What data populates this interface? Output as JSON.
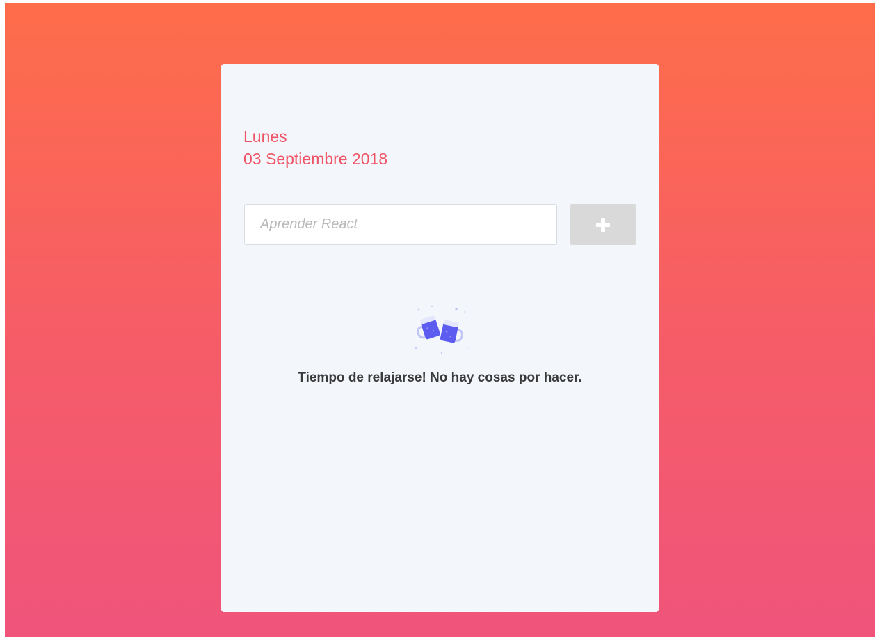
{
  "date": {
    "day": "Lunes",
    "full": "03 Septiembre 2018"
  },
  "task_input": {
    "value": "",
    "placeholder": "Aprender React"
  },
  "add_button": {
    "icon": "plus-icon"
  },
  "empty_state": {
    "icon": "beer-mugs-cheers-icon",
    "message": "Tiempo de relajarse! No hay cosas por hacer."
  },
  "colors": {
    "background_top": "#fe6d4a",
    "background_bottom": "#f0547b",
    "card": "#f3f6fb",
    "date_text": "#ef5466",
    "button_disabled": "#d9d9d9",
    "illustration_accent": "#5c5cf0"
  }
}
